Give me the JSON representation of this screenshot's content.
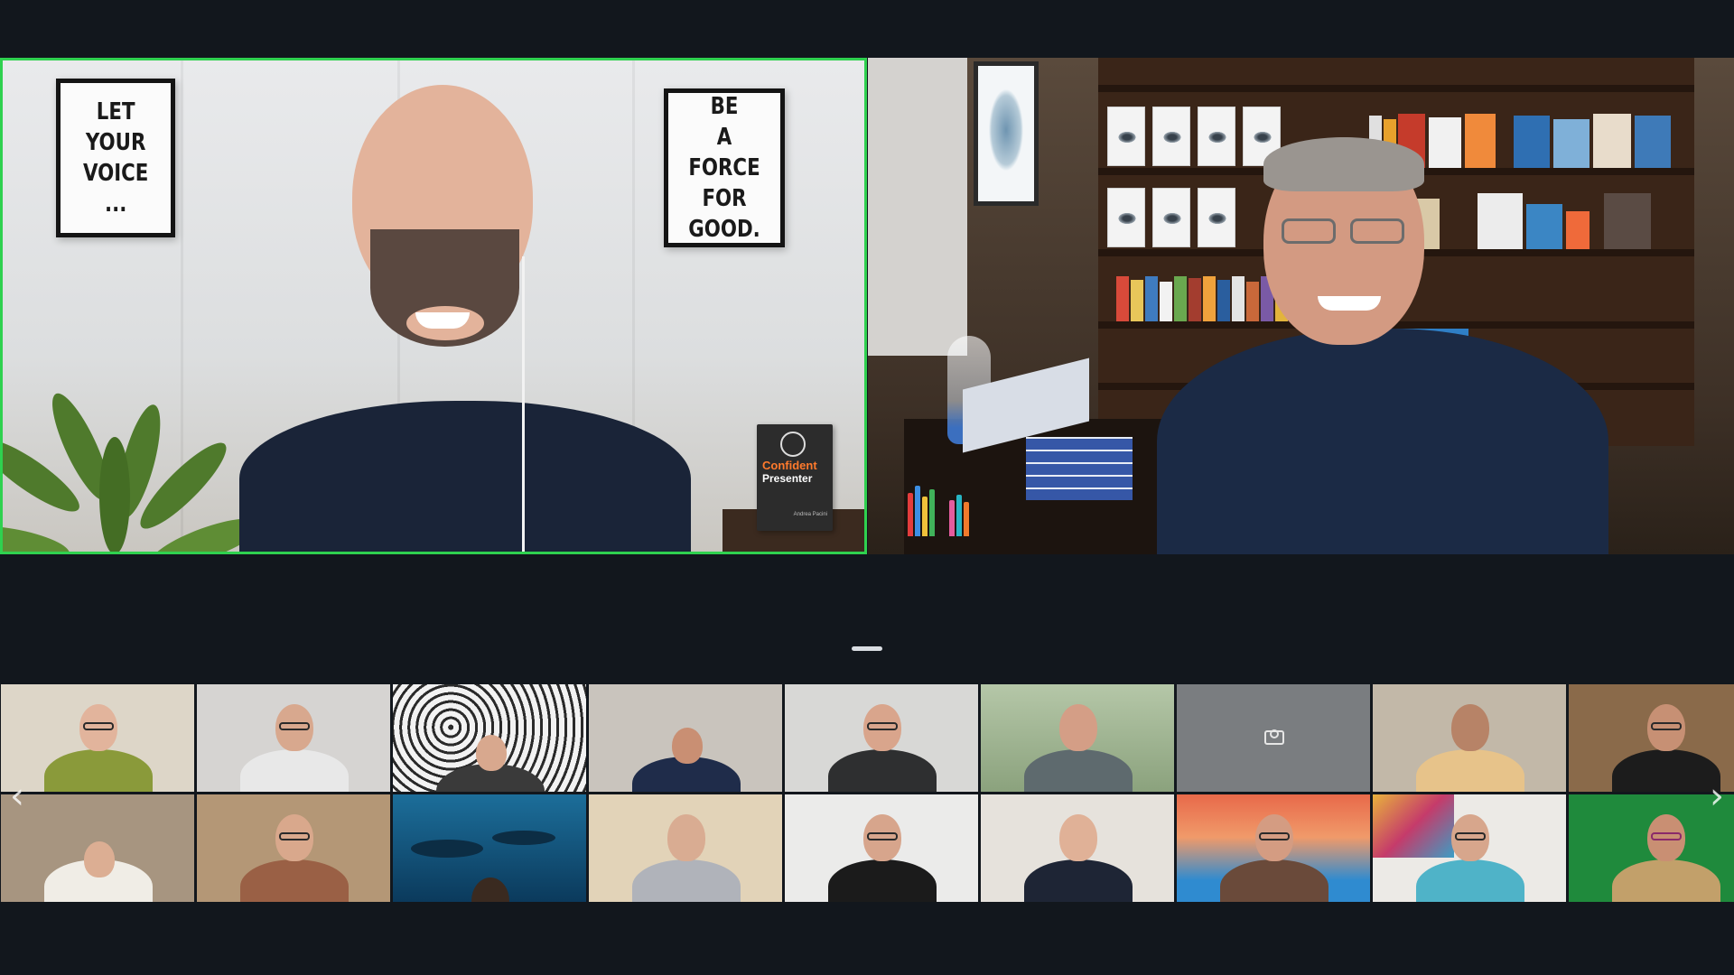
{
  "meeting": {
    "active_speaker_outline_color": "#2fd14f",
    "background_color": "#12171d"
  },
  "speaker_a": {
    "poster_left_text": "LET\nYOUR\nVOICE\n...",
    "poster_right_text": "BE\nA FORCE\nFOR\nGOOD.",
    "book_title_line1": "Confident",
    "book_title_line2": "Presenter",
    "book_author": "Andrea Pacini",
    "is_active_speaker": true
  },
  "speaker_b": {
    "is_active_speaker": false
  },
  "gallery": {
    "left_arrow_glyph": "‹",
    "right_arrow_glyph": "›",
    "camera_off_icon": "camera-off-icon"
  }
}
